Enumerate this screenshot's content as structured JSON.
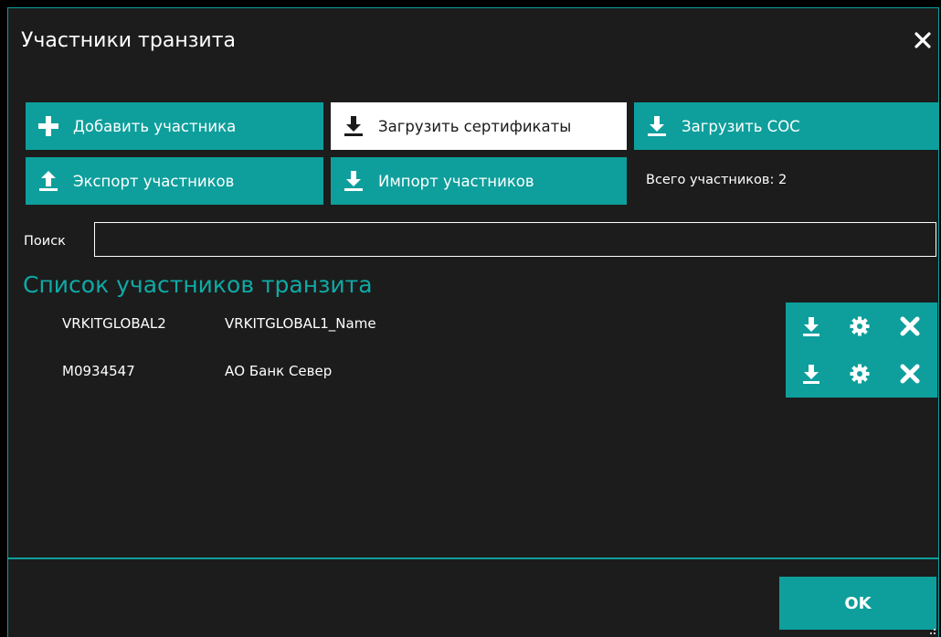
{
  "window": {
    "title": "Участники транзита"
  },
  "toolbar": {
    "add_participant": "Добавить участника",
    "load_certificates": "Загрузить сертификаты",
    "load_crl": "Загрузить СОС",
    "export_participants": "Экспорт участников",
    "import_participants": "Импорт участников",
    "total_participants": "Всего участников: 2"
  },
  "search": {
    "label": "Поиск",
    "value": "",
    "placeholder": ""
  },
  "list": {
    "header": "Список участников транзита",
    "rows": [
      {
        "code": "VRKITGLOBAL2",
        "name": "VRKITGLOBAL1_Name"
      },
      {
        "code": "M0934547",
        "name": "АО Банк Север"
      }
    ],
    "row_actions": [
      "download-icon",
      "gear-icon",
      "delete-x-icon"
    ]
  },
  "footer": {
    "ok_label": "OK"
  },
  "colors": {
    "accent": "#0e9f9c",
    "background": "#1c1c1c",
    "header_text": "#0eaaa5",
    "light_button": "#ffffff"
  }
}
